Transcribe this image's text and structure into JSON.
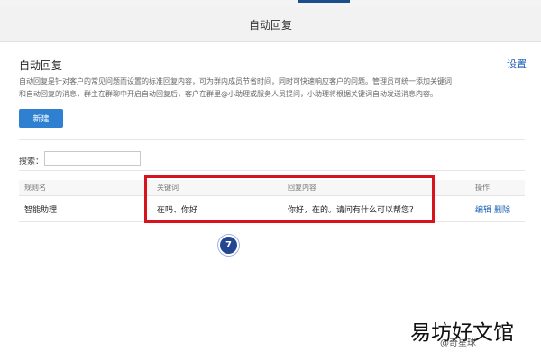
{
  "window": {
    "title": "自动回复"
  },
  "panel": {
    "title": "自动回复",
    "settings_label": "设置",
    "description_line1": "自动回复是针对客户的常见问题而设置的标准回复内容，可为群内成员节省时间，同时可快速响应客户的问题。管理员可统一添加关键词",
    "description_line2": "和自动回复的消息，群主在群聊中开启自动回复后，客户在群里@小助理或服务人员提问，小助理将根据关键词自动发送消息内容。",
    "new_button": "新建"
  },
  "search": {
    "label": "搜索：",
    "value": "",
    "placeholder": ""
  },
  "table": {
    "headers": [
      "规则名",
      "关键词",
      "回复内容",
      "操作"
    ],
    "rows": [
      {
        "rule": "智能助理",
        "keywords": "在吗、你好",
        "reply": "你好，在的。请问有什么可以帮您？",
        "edit": "编辑",
        "delete": "删除"
      }
    ]
  },
  "annotation": {
    "step": "7",
    "highlight_color": "#d8131d",
    "badge_color": "#244591"
  },
  "watermark": {
    "large": "易坊好文馆",
    "small": "@奇星球"
  },
  "colors": {
    "accent": "#2f80d1",
    "link": "#1a5fb4"
  }
}
